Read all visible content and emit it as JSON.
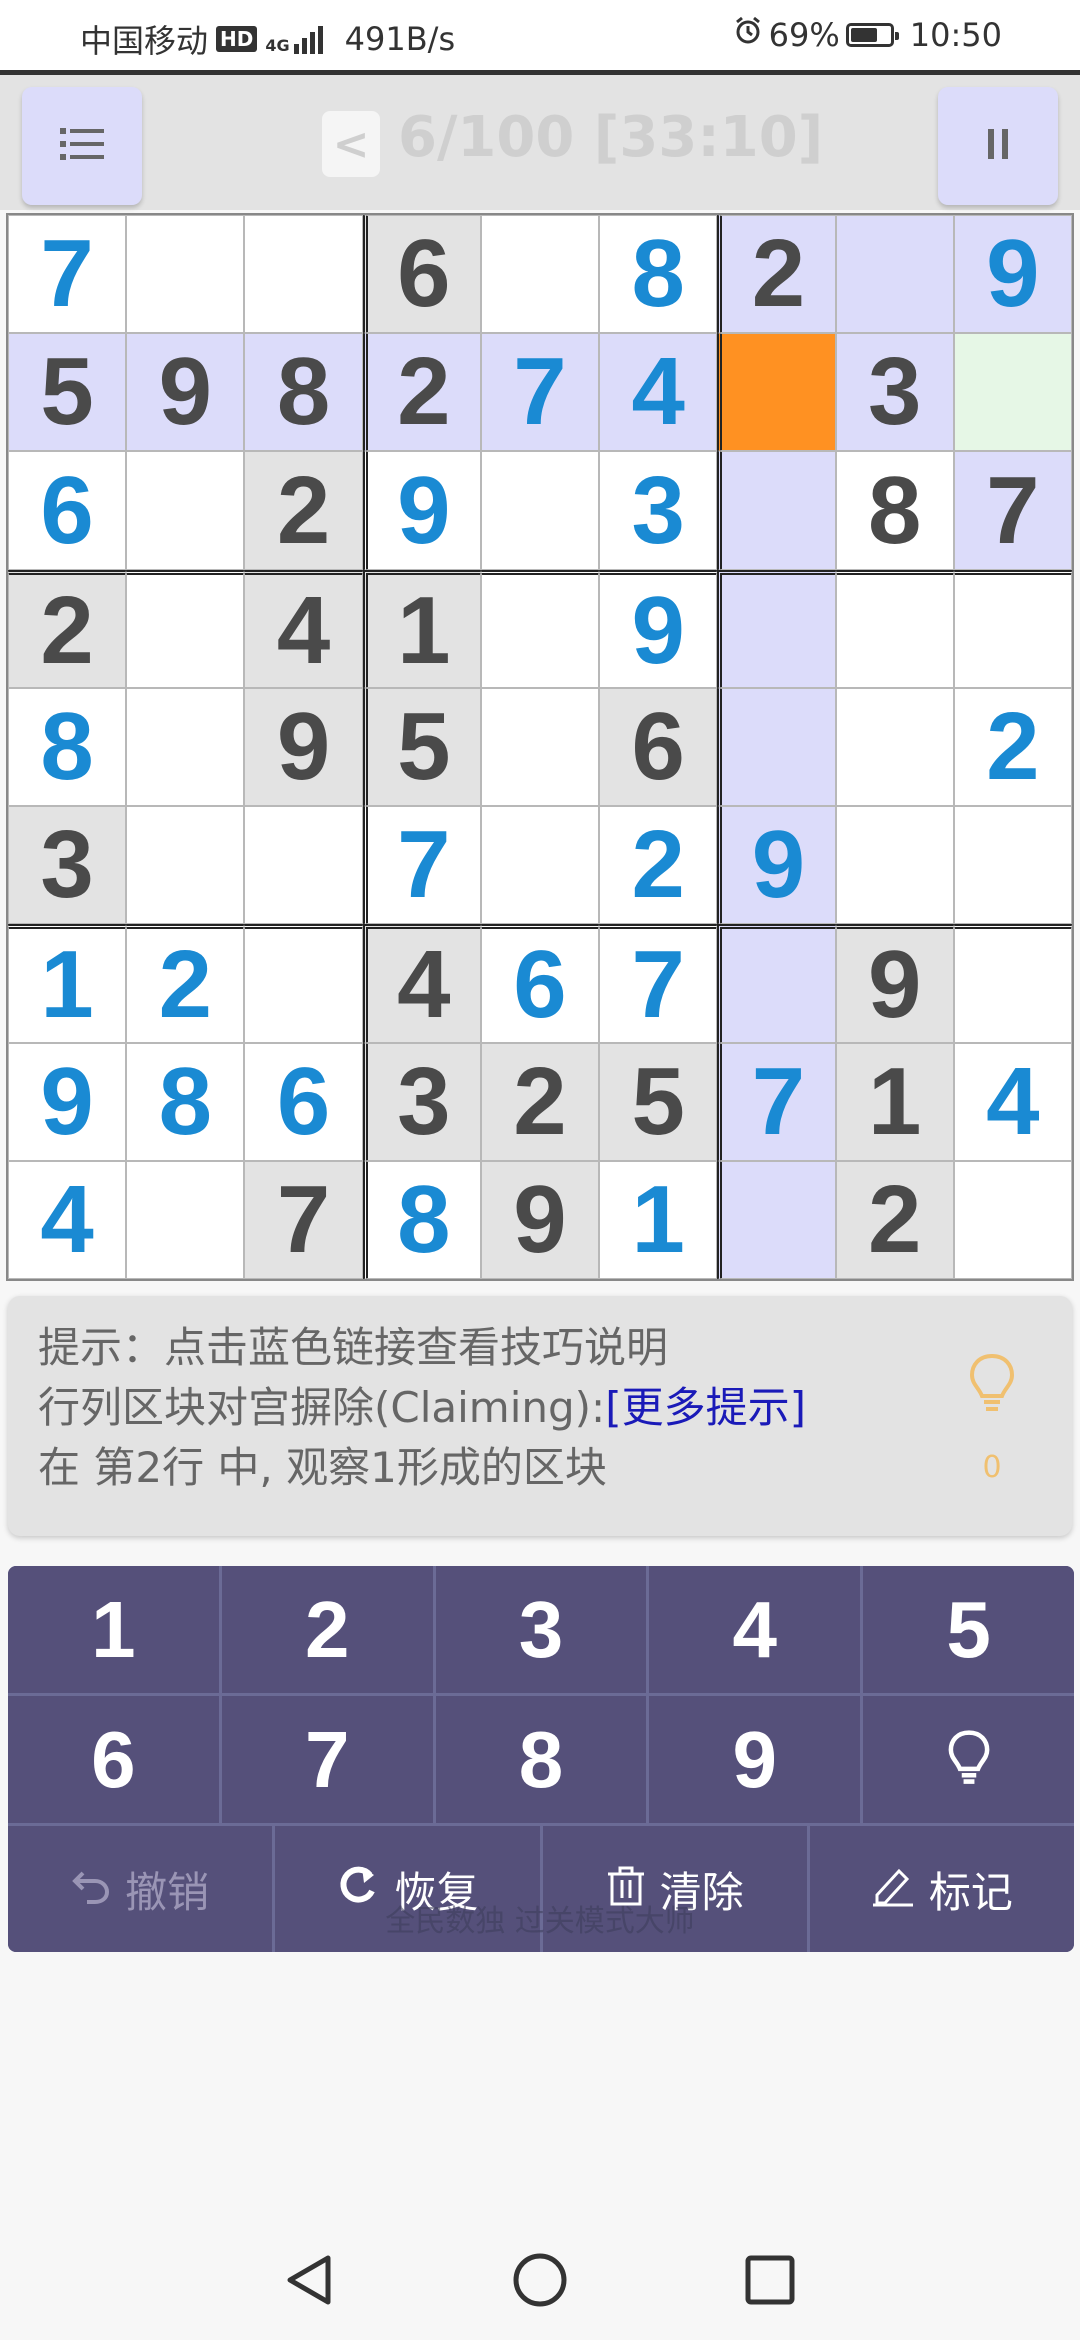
{
  "status_bar": {
    "carrier": "中国移动",
    "hd": "HD",
    "net": "4G",
    "speed": "491B/s",
    "battery": "69%",
    "battery_level": 0.69,
    "time": "10:50"
  },
  "header": {
    "prev_label": "<",
    "progress": "6/100 [33:10]"
  },
  "board": {
    "digits": [
      [
        "7",
        "",
        "",
        "6",
        "",
        "8",
        "2",
        "",
        "9"
      ],
      [
        "5",
        "9",
        "8",
        "2",
        "7",
        "4",
        "",
        "3",
        ""
      ],
      [
        "6",
        "",
        "2",
        "9",
        "",
        "3",
        "",
        "8",
        "7"
      ],
      [
        "2",
        "",
        "4",
        "1",
        "",
        "9",
        "",
        "",
        ""
      ],
      [
        "8",
        "",
        "9",
        "5",
        "",
        "6",
        "",
        "",
        "2"
      ],
      [
        "3",
        "",
        "",
        "7",
        "",
        "2",
        "9",
        "",
        ""
      ],
      [
        "1",
        "2",
        "",
        "4",
        "6",
        "7",
        "",
        "9",
        ""
      ],
      [
        "9",
        "8",
        "6",
        "3",
        "2",
        "5",
        "7",
        "1",
        "4"
      ],
      [
        "4",
        "",
        "7",
        "8",
        "9",
        "1",
        "",
        "2",
        ""
      ]
    ],
    "kinds": [
      [
        "u",
        "",
        "",
        "g",
        "",
        "u",
        "g",
        "",
        "u"
      ],
      [
        "g",
        "g",
        "g",
        "g",
        "u",
        "u",
        "",
        "g",
        ""
      ],
      [
        "u",
        "",
        "g",
        "u",
        "",
        "u",
        "",
        "g",
        "g"
      ],
      [
        "g",
        "",
        "g",
        "g",
        "",
        "u",
        "",
        "",
        ""
      ],
      [
        "u",
        "",
        "g",
        "g",
        "",
        "g",
        "",
        "",
        "u"
      ],
      [
        "g",
        "",
        "",
        "u",
        "",
        "u",
        "u",
        "",
        ""
      ],
      [
        "u",
        "u",
        "",
        "g",
        "u",
        "u",
        "",
        "g",
        ""
      ],
      [
        "u",
        "u",
        "u",
        "g",
        "g",
        "g",
        "u",
        "g",
        "u"
      ],
      [
        "u",
        "",
        "g",
        "u",
        "g",
        "u",
        "",
        "g",
        ""
      ]
    ],
    "backgrounds": [
      [
        "w",
        "w",
        "w",
        "g",
        "w",
        "w",
        "h",
        "h",
        "h"
      ],
      [
        "h",
        "h",
        "h",
        "h",
        "h",
        "h",
        "s",
        "h",
        "n"
      ],
      [
        "w",
        "w",
        "g",
        "w",
        "w",
        "w",
        "h",
        "w",
        "h"
      ],
      [
        "g",
        "w",
        "g",
        "g",
        "w",
        "w",
        "h",
        "w",
        "w"
      ],
      [
        "w",
        "w",
        "g",
        "g",
        "w",
        "g",
        "h",
        "w",
        "w"
      ],
      [
        "g",
        "w",
        "w",
        "w",
        "w",
        "w",
        "h",
        "w",
        "w"
      ],
      [
        "w",
        "w",
        "w",
        "g",
        "w",
        "w",
        "h",
        "g",
        "w"
      ],
      [
        "w",
        "w",
        "w",
        "g",
        "g",
        "g",
        "h",
        "g",
        "w"
      ],
      [
        "w",
        "w",
        "g",
        "w",
        "g",
        "w",
        "h",
        "g",
        "w"
      ]
    ],
    "colors": {
      "given_text": "#4a4a4a",
      "user_text": "#1a8ad3",
      "given_bg": "#e3e3e3",
      "highlight_bg": "#dcdcfa",
      "selected_bg": "#ff9122",
      "candidate_bg": "#e6f7e6"
    }
  },
  "hint": {
    "line1": "提示：点击蓝色链接查看技巧说明",
    "line2_prefix": "行列区块对宫摒除(Claiming):",
    "line2_link": "[更多提示]",
    "line3": "在 第2行 中, 观察1形成的区块",
    "count": "0"
  },
  "keypad": {
    "row1": [
      "1",
      "2",
      "3",
      "4",
      "5"
    ],
    "row2": [
      "6",
      "7",
      "8",
      "9"
    ],
    "undo": "撤销",
    "redo": "恢复",
    "clear": "清除",
    "mark": "标记"
  },
  "footer_text": "全民数独 过关模式大师"
}
